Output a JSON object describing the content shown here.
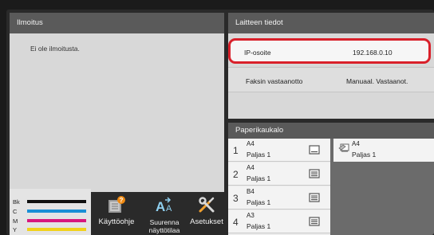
{
  "notification": {
    "title": "Ilmoitus",
    "message": "Ei ole ilmoitusta."
  },
  "device_info": {
    "title": "Laitteen tiedot",
    "ip_label": "IP-osoite",
    "ip_value": "192.168.0.10",
    "fax_label": "Faksin vastaanotto",
    "fax_value": "Manuaal. Vastaanot."
  },
  "paper_trays": {
    "title": "Paperikaukalo",
    "trays": [
      {
        "number": "1",
        "size": "A4",
        "type": "Paljas 1"
      },
      {
        "number": "2",
        "size": "A4",
        "type": "Paljas 1"
      },
      {
        "number": "3",
        "size": "B4",
        "type": "Paljas 1"
      },
      {
        "number": "4",
        "size": "A3",
        "type": "Paljas 1"
      }
    ],
    "bypass": {
      "size": "A4",
      "type": "Paljas 1"
    }
  },
  "toner": [
    {
      "label": "Bk",
      "color": "#111111"
    },
    {
      "label": "C",
      "color": "#1a8fd6"
    },
    {
      "label": "M",
      "color": "#d8177d"
    },
    {
      "label": "Y",
      "color": "#f1d21b"
    }
  ],
  "buttons": {
    "guide": "Käyttöohje",
    "zoom_line1": "Suurenna",
    "zoom_line2": "näyttötilaa",
    "settings": "Asetukset"
  }
}
